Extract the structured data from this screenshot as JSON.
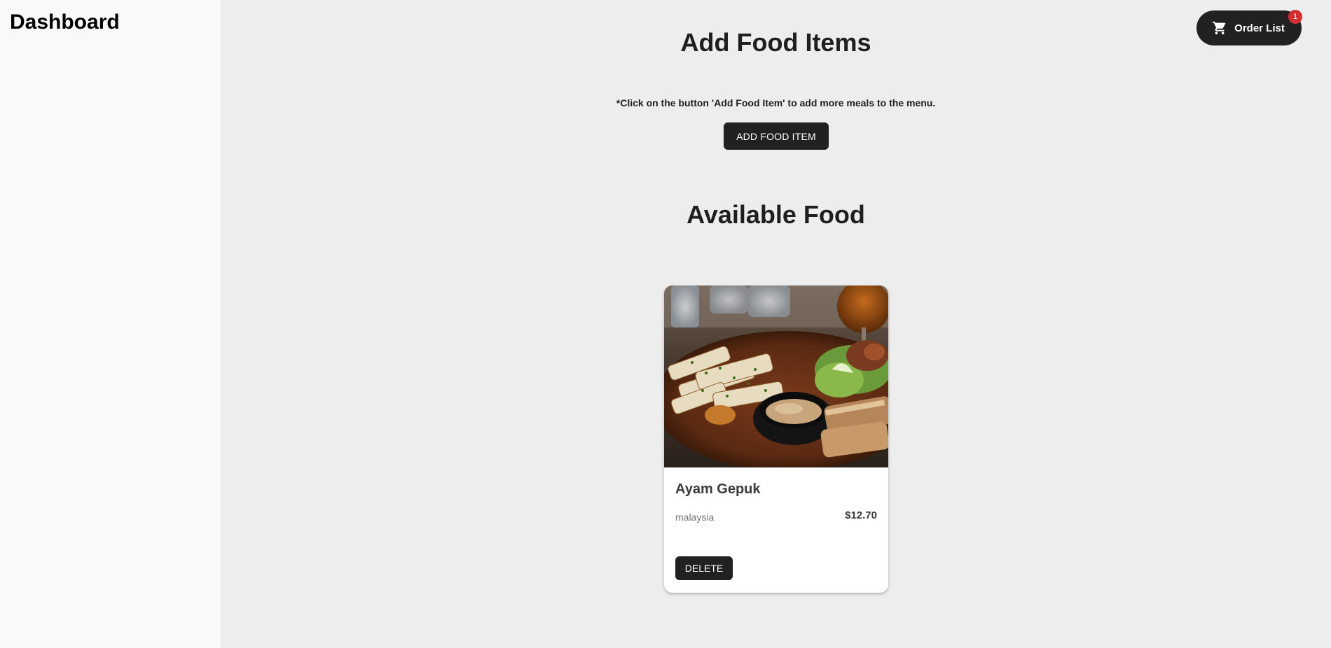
{
  "sidebar": {
    "title": "Dashboard"
  },
  "header": {
    "order_button": {
      "label": "Order List",
      "icon": "shopping-cart-icon",
      "badge_count": "1",
      "badge_color": "#d32f2f"
    }
  },
  "add_section": {
    "title": "Add Food Items",
    "instruction": "*Click on the button 'Add Food Item' to add more meals to the menu.",
    "button_label": "ADD FOOD ITEM"
  },
  "available_section": {
    "title": "Available Food",
    "items": [
      {
        "name": "Ayam Gepuk",
        "origin": "malaysia",
        "price": "$12.70",
        "delete_label": "DELETE",
        "image_alt": "Plate of grilled food with dipping sauce and salad"
      }
    ]
  },
  "colors": {
    "primary_button": "#212121",
    "main_background": "#ededed",
    "sidebar_background": "#f9f9f9",
    "card_background": "#ffffff"
  }
}
